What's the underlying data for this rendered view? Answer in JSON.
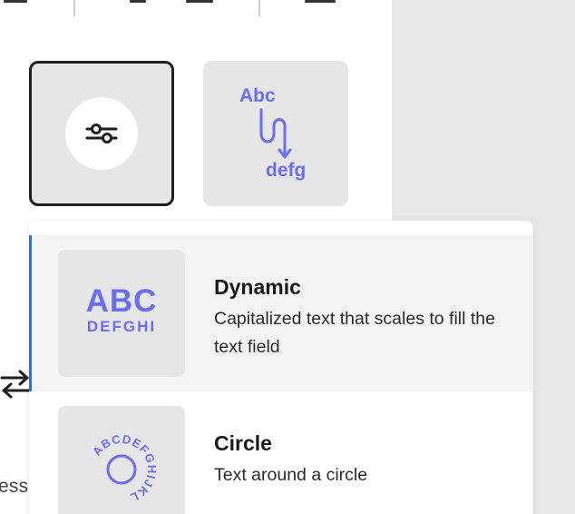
{
  "accent_color": "#2a72d8",
  "brand_color": "#6b6ef2",
  "toolbar": {
    "icons": [
      "menu-icon",
      "align-left-icon",
      "list-indent-icon",
      "check-list-icon"
    ]
  },
  "style_tiles": [
    {
      "name": "adjustments",
      "icon": "sliders-icon",
      "selected": true
    },
    {
      "name": "flow",
      "icon": "flow-text-icon",
      "top_text": "Abc",
      "bottom_text": "defg"
    }
  ],
  "sidebar_fragment": {
    "icon": "swap-arrows-icon",
    "text": "ess"
  },
  "popover": {
    "options": [
      {
        "title": "Dynamic",
        "description": "Capitalized text that scales to fill the text field",
        "thumb_big": "ABC",
        "thumb_small": "DEFGHI",
        "selected": true
      },
      {
        "title": "Circle",
        "description": "Text around a circle",
        "thumb_circle_text": "ABCDEFGHIJKL"
      }
    ]
  }
}
